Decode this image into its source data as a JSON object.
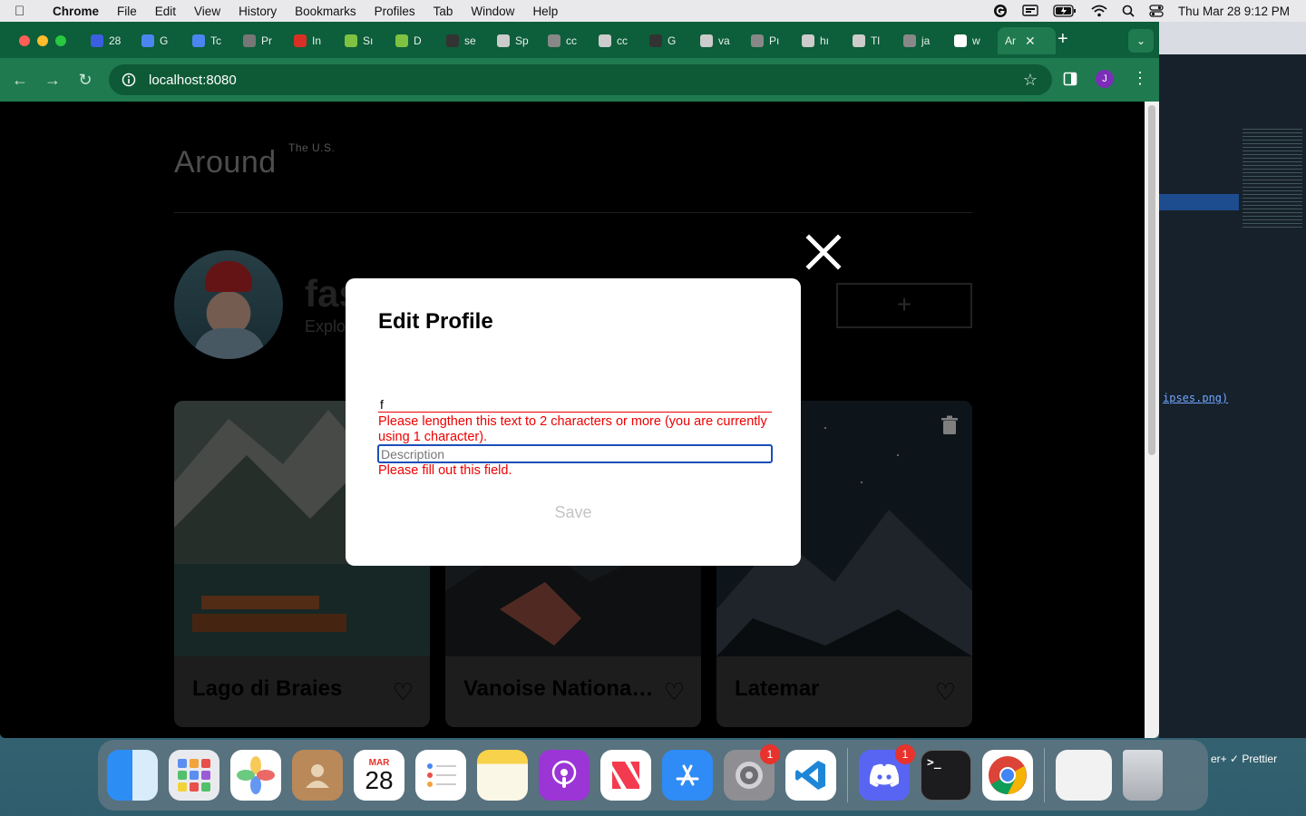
{
  "menubar": {
    "app": "Chrome",
    "items": [
      "File",
      "Edit",
      "View",
      "History",
      "Bookmarks",
      "Profiles",
      "Tab",
      "Window",
      "Help"
    ],
    "clock": "Thu Mar 28  9:12 PM"
  },
  "tabs": [
    {
      "label": "28",
      "color": "#3b5fe0"
    },
    {
      "label": "G",
      "color": "#4a86f0"
    },
    {
      "label": "Tc",
      "color": "#4a86f0"
    },
    {
      "label": "Pr",
      "color": "#777"
    },
    {
      "label": "In",
      "color": "#d93025"
    },
    {
      "label": "Sı",
      "color": "#7fc241"
    },
    {
      "label": "D",
      "color": "#7fc241"
    },
    {
      "label": "se",
      "color": "#333"
    },
    {
      "label": "Sp",
      "color": "#ccc"
    },
    {
      "label": "cc",
      "color": "#888"
    },
    {
      "label": "cc",
      "color": "#ccc"
    },
    {
      "label": "G",
      "color": "#333"
    },
    {
      "label": "va",
      "color": "#ccc"
    },
    {
      "label": "Pı",
      "color": "#888"
    },
    {
      "label": "hı",
      "color": "#ccc"
    },
    {
      "label": "Tl",
      "color": "#ccc"
    },
    {
      "label": "ja",
      "color": "#888"
    },
    {
      "label": "w",
      "color": "#fff"
    }
  ],
  "active_tab": "Ar",
  "address": "localhost:8080",
  "profile_initial": "J",
  "site": {
    "logo": "Around",
    "logo_sup": "The U.S.",
    "profile_name": "fas",
    "profile_about": "Explo",
    "add_button": "+"
  },
  "cards": [
    {
      "title": "Lago di Braies"
    },
    {
      "title": "Vanoise National Park"
    },
    {
      "title": "Latemar"
    }
  ],
  "modal": {
    "title": "Edit Profile",
    "name_value": "f",
    "name_error": "Please lengthen this text to 2 characters or more (you are currently using 1 character).",
    "desc_placeholder": "Description",
    "desc_error": "Please fill out this field.",
    "save": "Save"
  },
  "dock": {
    "calendar_month": "MAR",
    "calendar_day": "28",
    "settings_badge": "1",
    "discord_badge": "1"
  },
  "bg_window": {
    "code_fragment": "ipses.png)",
    "status": "er+   ✓ Prettier"
  }
}
